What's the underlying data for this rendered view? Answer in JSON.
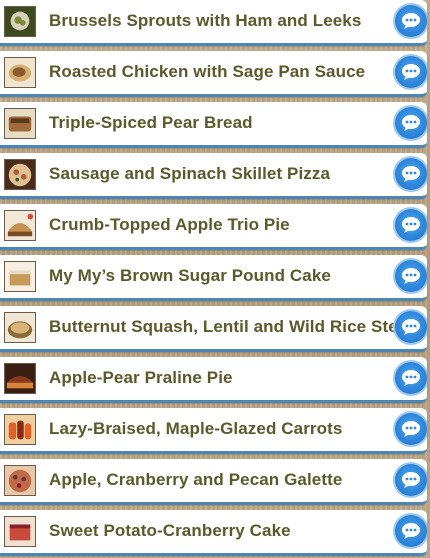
{
  "recipes": [
    {
      "title": "Brussels Sprouts with Ham and Leeks",
      "thumb": [
        "#3d4a1e",
        "#7a8a3a",
        "#d8d0b8"
      ],
      "icon": "chat-bubble-icon"
    },
    {
      "title": "Roasted Chicken with Sage Pan Sauce",
      "thumb": [
        "#8a5a2a",
        "#d7b070",
        "#f0e6cf"
      ],
      "icon": "chat-bubble-icon"
    },
    {
      "title": "Triple-Spiced Pear Bread",
      "thumb": [
        "#5a3a1e",
        "#a06a3a",
        "#e8dcc4"
      ],
      "icon": "chat-bubble-icon"
    },
    {
      "title": "Sausage and Spinach Skillet Pizza",
      "thumb": [
        "#4a2a1a",
        "#b05a30",
        "#e0c090"
      ],
      "icon": "chat-bubble-icon"
    },
    {
      "title": "Crumb-Topped Apple Trio Pie",
      "thumb": [
        "#7a4a24",
        "#c8904e",
        "#d84a3a"
      ],
      "icon": "chat-bubble-icon"
    },
    {
      "title": "My My’s Brown Sugar Pound Cake",
      "thumb": [
        "#e8dcc8",
        "#c89a5a",
        "#f6efe2"
      ],
      "icon": "chat-bubble-icon"
    },
    {
      "title": "Butternut Squash, Lentil and Wild Rice Stew",
      "thumb": [
        "#8a6a3a",
        "#d8b478",
        "#efe6d4"
      ],
      "icon": "chat-bubble-icon"
    },
    {
      "title": "Apple-Pear Praline Pie",
      "thumb": [
        "#3a1e12",
        "#8a3a1e",
        "#d8843a"
      ],
      "icon": "chat-bubble-icon"
    },
    {
      "title": "Lazy-Braised, Maple-Glazed Carrots",
      "thumb": [
        "#8a2a12",
        "#e0602a",
        "#f0d0a0"
      ],
      "icon": "chat-bubble-icon"
    },
    {
      "title": "Apple, Cranberry and Pecan Galette",
      "thumb": [
        "#6a3a2a",
        "#c06a4a",
        "#e8c8a8"
      ],
      "icon": "chat-bubble-icon"
    },
    {
      "title": "Sweet Potato-Cranberry Cake",
      "thumb": [
        "#8a1e2a",
        "#c84a3a",
        "#f0e0d0"
      ],
      "icon": "chat-bubble-icon"
    }
  ]
}
